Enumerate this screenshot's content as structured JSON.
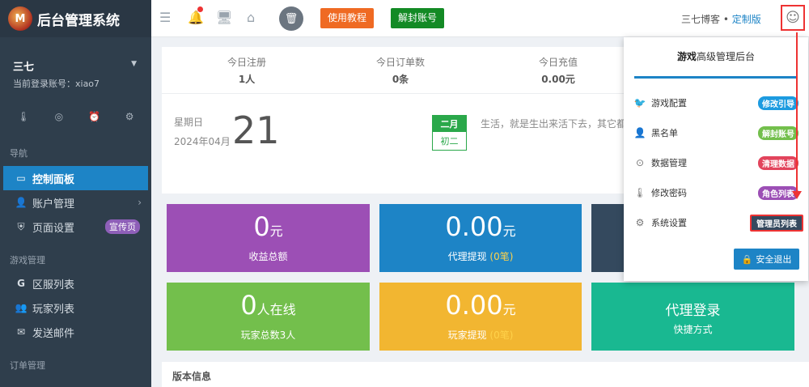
{
  "brand": {
    "title": "后台管理系统",
    "logo_text": "M"
  },
  "user": {
    "name": "三七",
    "account_label": "当前登录账号：xiao7"
  },
  "sidebar": {
    "nav_label": "导航",
    "items": [
      {
        "label": "控制面板",
        "icon": "monitor-icon"
      },
      {
        "label": "账户管理",
        "icon": "user-icon"
      },
      {
        "label": "页面设置",
        "icon": "shield-icon",
        "badge": "宣传页"
      }
    ],
    "game_label": "游戏管理",
    "game_items": [
      {
        "label": "区服列表",
        "icon": "google-icon"
      },
      {
        "label": "玩家列表",
        "icon": "users-icon"
      },
      {
        "label": "发送邮件",
        "icon": "mail-icon"
      }
    ],
    "order_label": "订单管理"
  },
  "topbar": {
    "tutorial_label": "使用教程",
    "unseal_label": "解封账号",
    "site_name": "三七博客 •",
    "site_link": "定制版"
  },
  "stats": [
    {
      "label": "今日注册",
      "value": "1人"
    },
    {
      "label": "今日订单数",
      "value": "0条"
    },
    {
      "label": "今日充值",
      "value": "0.00元"
    }
  ],
  "calendar": {
    "weekday": "星期日",
    "year_month": "2024年04月",
    "day": "21",
    "lunar_month": "二月",
    "lunar_day": "初二",
    "motto": "生活，就是生出来活下去，其它都"
  },
  "tiles": [
    {
      "value": "0",
      "unit": "元",
      "label": "收益总额",
      "color": "#9c4fb5"
    },
    {
      "value": "0.00",
      "unit": "元",
      "label": "代理提现",
      "extra": "(0笔)",
      "color": "#1d84c6"
    },
    {
      "value": "0",
      "unit": "人在线",
      "label": "玩家总数3人",
      "color": "#73bf4c"
    },
    {
      "value": "0.00",
      "unit": "元",
      "label": "玩家提现",
      "extra": "(0笔)",
      "color": "#f2b631"
    },
    {
      "title": "代理登录",
      "label": "快捷方式",
      "color": "#19b891"
    }
  ],
  "version": {
    "label": "版本信息"
  },
  "dropdown": {
    "title_bold": "游戏",
    "title_rest": "高级管理后台",
    "items": [
      {
        "label": "游戏配置",
        "badge": "修改引导",
        "badge_color": "#1d9be0",
        "icon": "twitter-icon"
      },
      {
        "label": "黑名单",
        "badge": "解封账号",
        "badge_color": "#73bf4c",
        "icon": "user-icon"
      },
      {
        "label": "数据管理",
        "badge": "清理数据",
        "badge_color": "#e2445c",
        "icon": "database-icon"
      },
      {
        "label": "修改密码",
        "badge": "角色列表",
        "badge_color": "#9c4fb5",
        "icon": "thermometer-icon"
      },
      {
        "label": "系统设置",
        "badge": "管理员列表",
        "badge_color": "#34495e",
        "icon": "gear-icon"
      }
    ],
    "logout_label": "安全退出"
  }
}
